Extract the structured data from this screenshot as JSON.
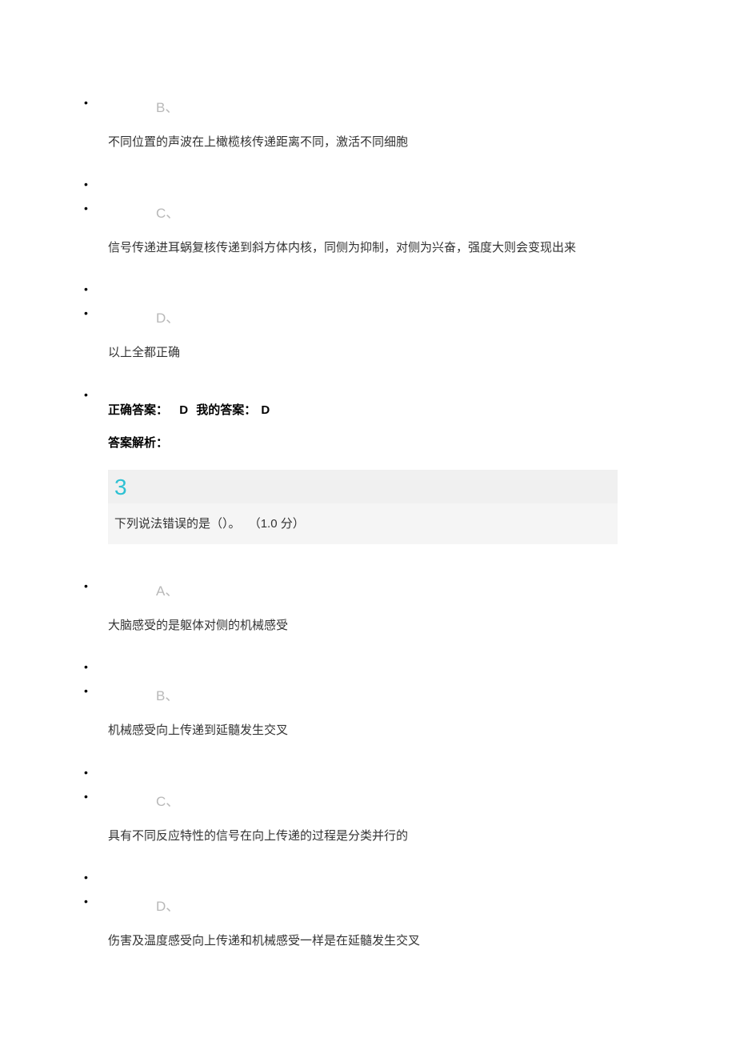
{
  "q2_partial": {
    "options": [
      {
        "letter": "B、",
        "text": "不同位置的声波在上橄榄核传递距离不同，激活不同细胞"
      },
      {
        "letter": "C、",
        "text": "信号传递进耳蜗复核传递到斜方体内核，同侧为抑制，对侧为兴奋，强度大则会变现出来"
      },
      {
        "letter": "D、",
        "text": "以上全都正确"
      }
    ],
    "answer": {
      "correct_label": "正确答案：",
      "correct_value": "D",
      "my_label": "我的答案：",
      "my_value": "D"
    },
    "explanation_label": "答案解析："
  },
  "q3": {
    "number": "3",
    "stem": "下列说法错误的是（）。",
    "points": "（1.0 分）",
    "options": [
      {
        "letter": "A、",
        "text": "大脑感受的是躯体对侧的机械感受"
      },
      {
        "letter": "B、",
        "text": "机械感受向上传递到延髓发生交叉"
      },
      {
        "letter": "C、",
        "text": "具有不同反应特性的信号在向上传递的过程是分类并行的"
      },
      {
        "letter": "D、",
        "text": "伤害及温度感受向上传递和机械感受一样是在延髓发生交叉"
      }
    ]
  }
}
